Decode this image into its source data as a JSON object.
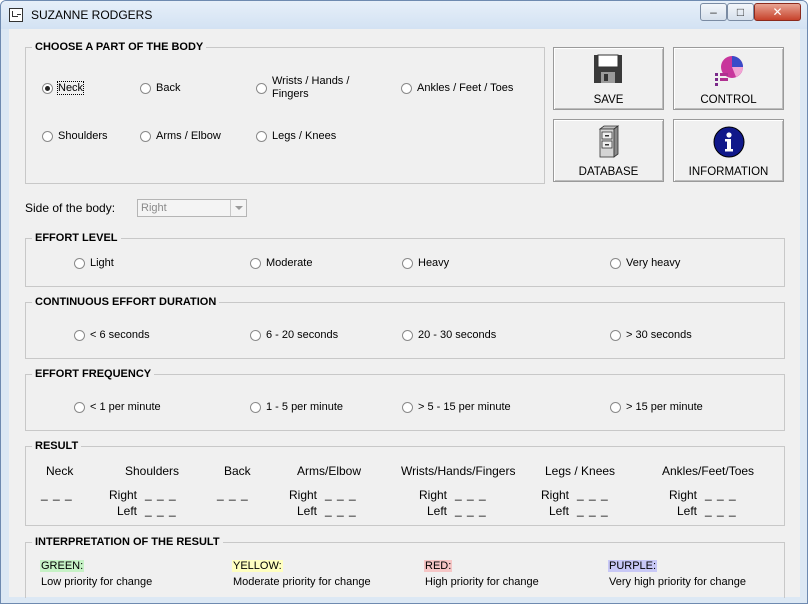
{
  "window": {
    "title": "SUZANNE RODGERS"
  },
  "body_part": {
    "legend": "CHOOSE A PART OF THE BODY",
    "options": [
      {
        "label": "Neck",
        "checked": true
      },
      {
        "label": "Back",
        "checked": false
      },
      {
        "label": "Wrists / Hands /",
        "label2": "Fingers",
        "checked": false
      },
      {
        "label": "Ankles / Feet / Toes",
        "checked": false
      },
      {
        "label": "Shoulders",
        "checked": false
      },
      {
        "label": "Arms / Elbow",
        "checked": false
      },
      {
        "label": "Legs / Knees",
        "checked": false
      }
    ]
  },
  "toolbar": {
    "save": "SAVE",
    "control": "CONTROL",
    "database": "DATABASE",
    "information": "INFORMATION"
  },
  "side": {
    "label": "Side of the body:",
    "value": "Right"
  },
  "effort_level": {
    "legend": "EFFORT LEVEL",
    "options": [
      "Light",
      "Moderate",
      "Heavy",
      "Very heavy"
    ]
  },
  "duration": {
    "legend": "CONTINUOUS EFFORT DURATION",
    "options": [
      "< 6 seconds",
      "6 - 20 seconds",
      "20 - 30 seconds",
      "> 30 seconds"
    ]
  },
  "frequency": {
    "legend": "EFFORT FREQUENCY",
    "options": [
      "< 1 per minute",
      "1 - 5 per minute",
      "> 5 - 15 per minute",
      "> 15 per minute"
    ]
  },
  "result": {
    "legend": "RESULT",
    "headers": [
      "Neck",
      "Shoulders",
      "Back",
      "Arms/Elbow",
      "Wrists/Hands/Fingers",
      "Legs / Knees",
      "Ankles/Feet/Toes"
    ],
    "right": "Right",
    "left": "Left",
    "blank": "_ _ _"
  },
  "interpretation": {
    "legend": "INTERPRETATION OF THE RESULT",
    "items": [
      {
        "color_name": "GREEN:",
        "desc": "Low priority for change",
        "bg": "#c6f2c6"
      },
      {
        "color_name": "YELLOW:",
        "desc": "Moderate priority for change",
        "bg": "#ffffc0"
      },
      {
        "color_name": "RED:",
        "desc": "High priority for change",
        "bg": "#f6c6c6"
      },
      {
        "color_name": "PURPLE:",
        "desc": "Very high priority for change",
        "bg": "#c8c8f6"
      }
    ]
  }
}
